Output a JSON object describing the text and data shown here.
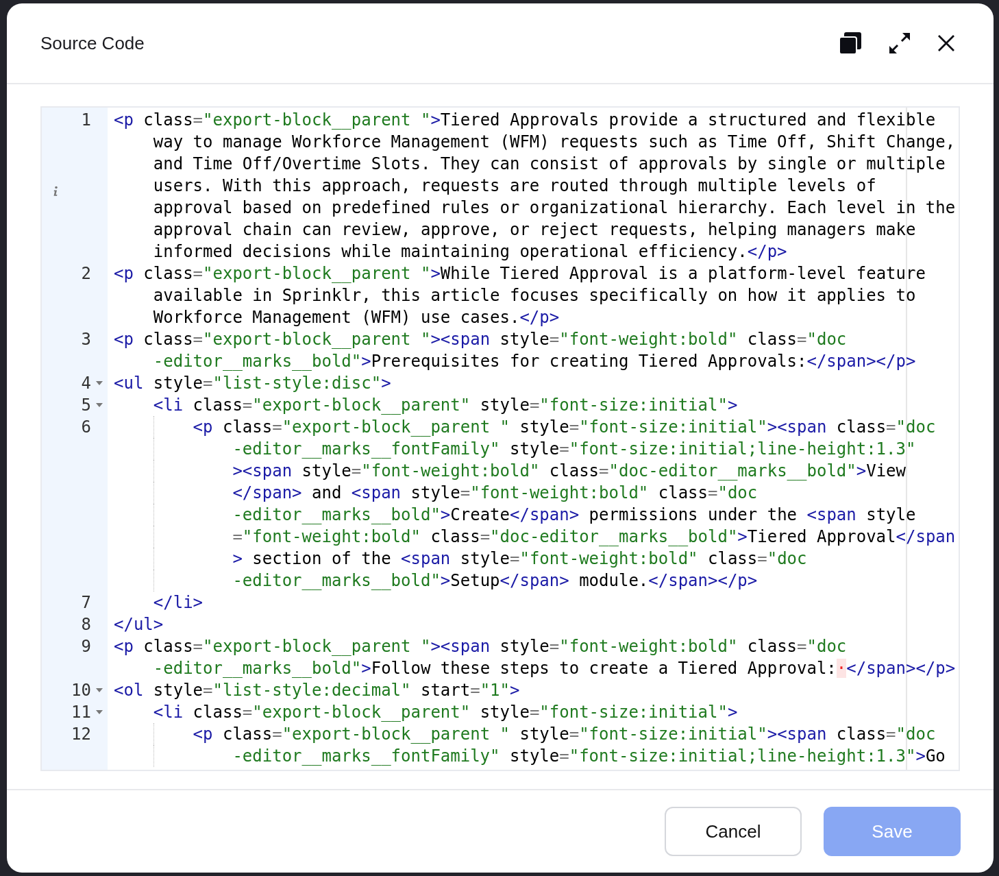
{
  "dialog": {
    "title": "Source Code",
    "editor": {
      "lines": [
        {
          "number": "1",
          "foldable": false,
          "rows": [
            "<p class=\"export-block__parent \">Tiered Approvals provide a structured and flexible",
            "way to manage Workforce Management (WFM) requests such as Time Off, Shift Change,",
            "and Time Off/Overtime Slots. They can consist of approvals by single or multiple",
            "users. With this approach, requests are routed through multiple levels of",
            "approval based on predefined rules or organizational hierarchy. Each level in the",
            "approval chain can review, approve, or reject requests, helping managers make",
            "informed decisions while maintaining operational efficiency.</p>"
          ]
        },
        {
          "number": "2",
          "foldable": false,
          "rows": [
            "<p class=\"export-block__parent \">While Tiered Approval is a platform-level feature",
            "available in Sprinklr, this article focuses specifically on how it applies to",
            "Workforce Management (WFM) use cases.</p>"
          ]
        },
        {
          "number": "3",
          "foldable": false,
          "rows": [
            "<p class=\"export-block__parent \"><span style=\"font-weight:bold\" class=\"doc",
            "-editor__marks__bold\">Prerequisites for creating Tiered Approvals:</span></p>"
          ]
        },
        {
          "number": "4",
          "foldable": true,
          "rows": [
            "<ul style=\"list-style:disc\">"
          ]
        },
        {
          "number": "5",
          "foldable": true,
          "rows": [
            "    <li class=\"export-block__parent\" style=\"font-size:initial\">"
          ]
        },
        {
          "number": "6",
          "foldable": false,
          "rows": [
            "        <p class=\"export-block__parent \" style=\"font-size:initial\"><span class=\"doc",
            "-editor__marks__fontFamily\" style=\"font-size:initial;line-height:1.3\"",
            "><span style=\"font-weight:bold\" class=\"doc-editor__marks__bold\">View",
            "</span> and <span style=\"font-weight:bold\" class=\"doc",
            "-editor__marks__bold\">Create</span> permissions under the <span style",
            "=\"font-weight:bold\" class=\"doc-editor__marks__bold\">Tiered Approval</span",
            "> section of the <span style=\"font-weight:bold\" class=\"doc",
            "-editor__marks__bold\">Setup</span> module.</span></p>"
          ]
        },
        {
          "number": "7",
          "foldable": false,
          "rows": [
            "    </li>"
          ]
        },
        {
          "number": "8",
          "foldable": false,
          "rows": [
            "</ul>"
          ]
        },
        {
          "number": "9",
          "foldable": false,
          "rows": [
            "<p class=\"export-block__parent \"><span style=\"font-weight:bold\" class=\"doc",
            "-editor__marks__bold\">Follow these steps to create a Tiered Approval:·</span></p>"
          ]
        },
        {
          "number": "10",
          "foldable": true,
          "rows": [
            "<ol style=\"list-style:decimal\" start=\"1\">"
          ]
        },
        {
          "number": "11",
          "foldable": true,
          "rows": [
            "    <li class=\"export-block__parent\" style=\"font-size:initial\">"
          ]
        },
        {
          "number": "12",
          "foldable": false,
          "rows": [
            "        <p class=\"export-block__parent \" style=\"font-size:initial\"><span class=\"doc",
            "-editor__marks__fontFamily\" style=\"font-size:initial;line-height:1.3\">Go"
          ]
        }
      ]
    },
    "buttons": [
      {
        "label": "Cancel",
        "kind": "secondary",
        "disabled": false
      },
      {
        "label": "Save",
        "kind": "primary",
        "disabled": true
      }
    ]
  }
}
